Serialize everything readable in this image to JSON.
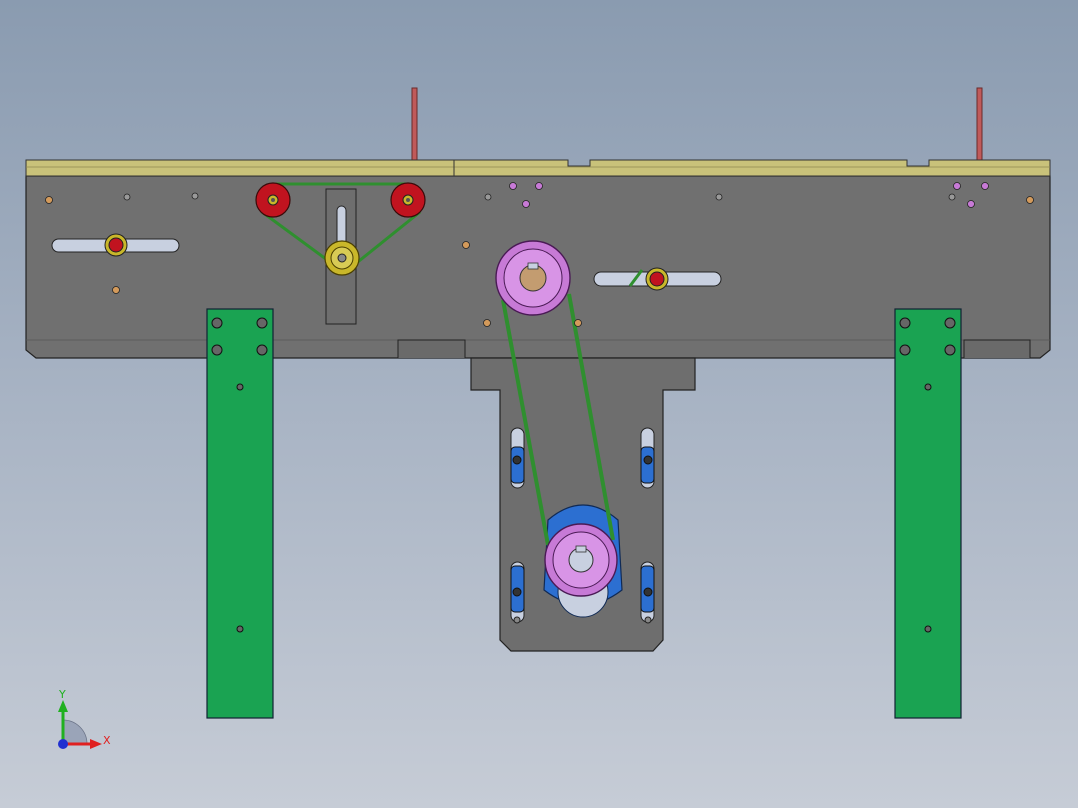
{
  "viewport": {
    "background_top": "#8a9bb0",
    "background_bottom": "#c6ccd6"
  },
  "triad": {
    "x_label": "X",
    "y_label": "Y",
    "x_color": "#e02020",
    "y_color": "#20b020",
    "z_color": "#2030d0"
  },
  "colors": {
    "frame_plate": "#707070",
    "top_strip": "#c9c27a",
    "leg": "#1aa352",
    "idler_pulley": "#c1131f",
    "tension_pulley": "#c9b72a",
    "drive_pulley": "#c77ad6",
    "motor": "#2c6fd1",
    "belt": "#2f8f2f",
    "rod": "#c05a5a"
  },
  "model": {
    "components": [
      "frame-plate",
      "top-strip",
      "left-leg",
      "right-leg",
      "motor-bracket",
      "upper-drive-pulley",
      "lower-drive-pulley",
      "left-idler-pulley",
      "right-idler-pulley",
      "tension-pulley",
      "motor",
      "belt",
      "rods"
    ]
  }
}
